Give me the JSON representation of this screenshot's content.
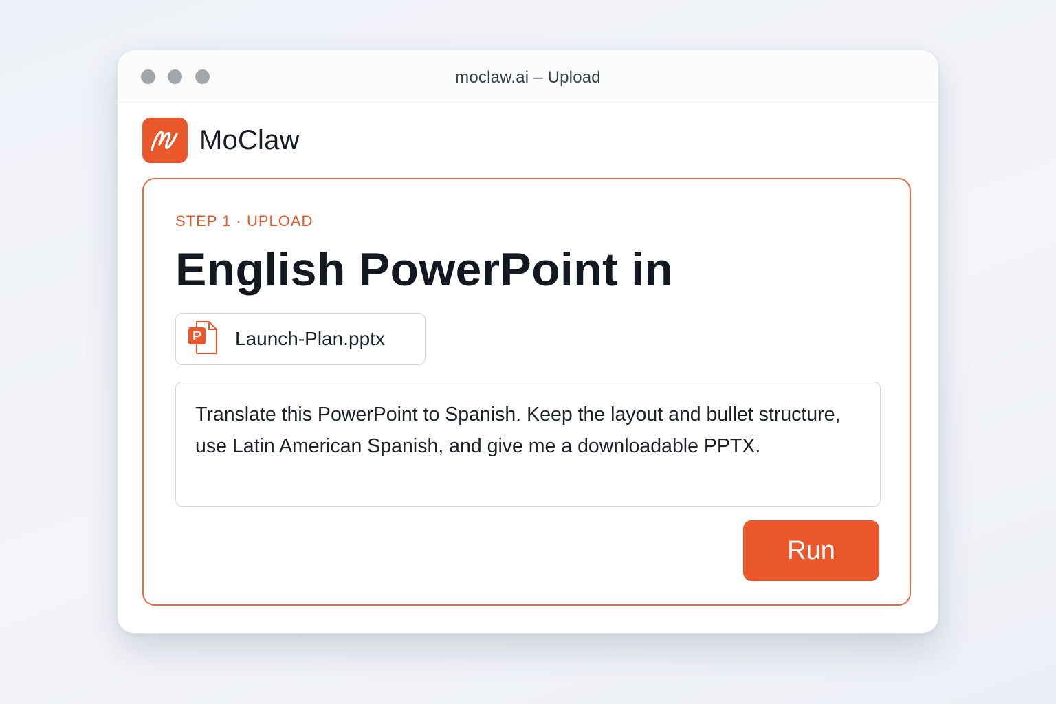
{
  "window": {
    "title": "moclaw.ai – Upload"
  },
  "brand": {
    "name": "MoClaw",
    "logo_icon": "scribble-signature-icon",
    "accent_color": "#e9572b"
  },
  "card": {
    "step_label": "STEP 1 · UPLOAD",
    "headline": "English PowerPoint in",
    "file": {
      "name": "Launch-Plan.pptx",
      "icon": "powerpoint-file-icon"
    },
    "prompt": {
      "value": "Translate this PowerPoint to Spanish. Keep the layout and bullet structure, use Latin American Spanish, and give me a downloadable PPTX."
    },
    "run_button": {
      "label": "Run"
    }
  }
}
